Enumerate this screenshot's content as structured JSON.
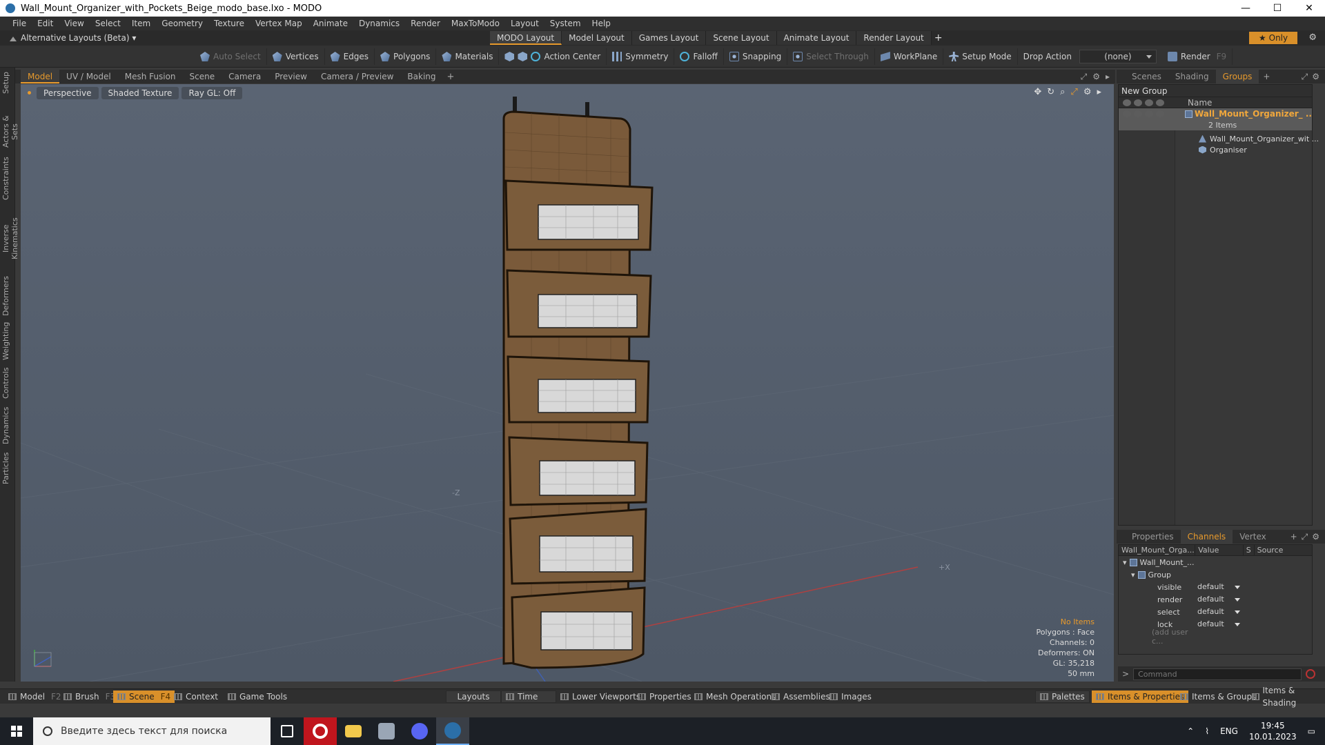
{
  "window": {
    "title": "Wall_Mount_Organizer_with_Pockets_Beige_modo_base.lxo - MODO",
    "minimize": "—",
    "maximize": "☐",
    "close": "✕"
  },
  "menu": [
    "File",
    "Edit",
    "View",
    "Select",
    "Item",
    "Geometry",
    "Texture",
    "Vertex Map",
    "Animate",
    "Dynamics",
    "Render",
    "MaxToModo",
    "Layout",
    "System",
    "Help"
  ],
  "layouts": {
    "alt_label": "Alternative Layouts (Beta) ▾",
    "tabs": [
      "MODO Layout",
      "Model Layout",
      "Games Layout",
      "Scene Layout",
      "Animate Layout",
      "Render Layout"
    ],
    "add": "+",
    "only": "Only",
    "star": "★"
  },
  "toolbar": {
    "auto_select": "Auto Select",
    "vertices": "Vertices",
    "edges": "Edges",
    "polygons": "Polygons",
    "materials": "Materials",
    "action_center": "Action Center",
    "symmetry": "Symmetry",
    "falloff": "Falloff",
    "snapping": "Snapping",
    "select_through": "Select Through",
    "workplane": "WorkPlane",
    "setup_mode": "Setup Mode",
    "drop_action": "Drop Action",
    "drop_value": "(none)",
    "render": "Render",
    "render_key": "F9"
  },
  "left_tabs": [
    "Setup",
    "Actors & Sets",
    "Constraints",
    "Inverse Kinematics",
    "Deformers",
    "Weighting",
    "Controls",
    "Dynamics",
    "Particles"
  ],
  "viewport_tabs": [
    "Model",
    "UV / Model",
    "Mesh Fusion",
    "Scene",
    "Camera",
    "Preview",
    "Camera / Preview",
    "Baking"
  ],
  "viewport": {
    "perspective": "Perspective",
    "shading": "Shaded Texture",
    "raygl": "Ray GL: Off",
    "axis_neg_z": "-Z",
    "axis_pos_x": "+X",
    "stats": {
      "no_items": "No Items",
      "polygons": "Polygons : Face",
      "channels": "Channels: 0",
      "deformers": "Deformers: ON",
      "gl": "GL: 35,218",
      "focal": "50 mm"
    }
  },
  "right_top_tabs": [
    "Scenes",
    "Shading",
    "Groups"
  ],
  "groups": {
    "new_group": "New Group",
    "name_header": "Name",
    "group_name": "Wall_Mount_Organizer_ ...",
    "item_count": "2 Items",
    "child1": "Wall_Mount_Organizer_wit ...",
    "child2": "Organiser"
  },
  "right_mid_tabs": [
    "Properties",
    "Channels",
    "Vertex Maps"
  ],
  "channels": {
    "col_name": "Wall_Mount_Orga...",
    "col_value": "Value",
    "col_s": "S",
    "col_source": "Source",
    "item": "Wall_Mount_...",
    "group": "Group",
    "rows": [
      {
        "name": "visible",
        "value": "default"
      },
      {
        "name": "render",
        "value": "default"
      },
      {
        "name": "select",
        "value": "default"
      },
      {
        "name": "lock",
        "value": "default"
      }
    ],
    "add_user": "(add user c..."
  },
  "command": {
    "prompt": ">",
    "placeholder": "Command"
  },
  "bottom": {
    "model": "Model",
    "model_key": "F2",
    "brush": "Brush",
    "brush_key": "F3",
    "scene": "Scene",
    "scene_key": "F4",
    "context": "Context",
    "game_tools": "Game Tools",
    "layouts": "Layouts",
    "time": "Time",
    "lower_viewports": "Lower Viewports",
    "properties": "Properties",
    "mesh_operations": "Mesh Operations",
    "assemblies": "Assemblies",
    "images": "Images",
    "palettes": "Palettes",
    "items_properties": "Items & Properties",
    "items_groups": "Items & Groups",
    "items_shading": "Items & Shading"
  },
  "taskbar": {
    "search_placeholder": "Введите здесь текст для поиска",
    "lang": "ENG",
    "time": "19:45",
    "date": "10.01.2023"
  },
  "colors": {
    "accent": "#e89a2c",
    "viewport": "#55606e"
  }
}
